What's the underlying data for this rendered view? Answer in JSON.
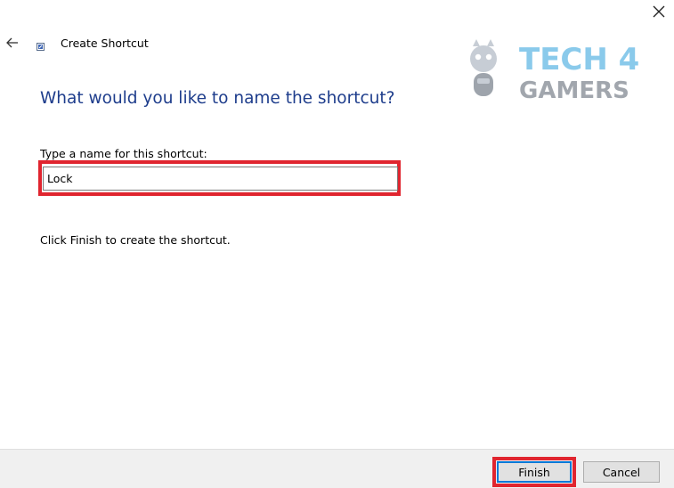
{
  "window": {
    "close_icon": "close-icon"
  },
  "header": {
    "back_icon": "arrow-left-icon",
    "title": "Create Shortcut"
  },
  "logo": {
    "name": "tech4gamers-logo",
    "line1": "TECH 4",
    "line2": "GAMERS"
  },
  "main": {
    "heading": "What would you like to name the shortcut?",
    "name_label": "Type a name for this shortcut:",
    "name_value": "Lock",
    "instruction": "Click Finish to create the shortcut."
  },
  "footer": {
    "finish_label": "Finish",
    "cancel_label": "Cancel"
  },
  "colors": {
    "heading": "#1e3d8c",
    "highlight": "#e0252f",
    "focus_border": "#0078d7",
    "footer_bg": "#f0f0f0"
  }
}
